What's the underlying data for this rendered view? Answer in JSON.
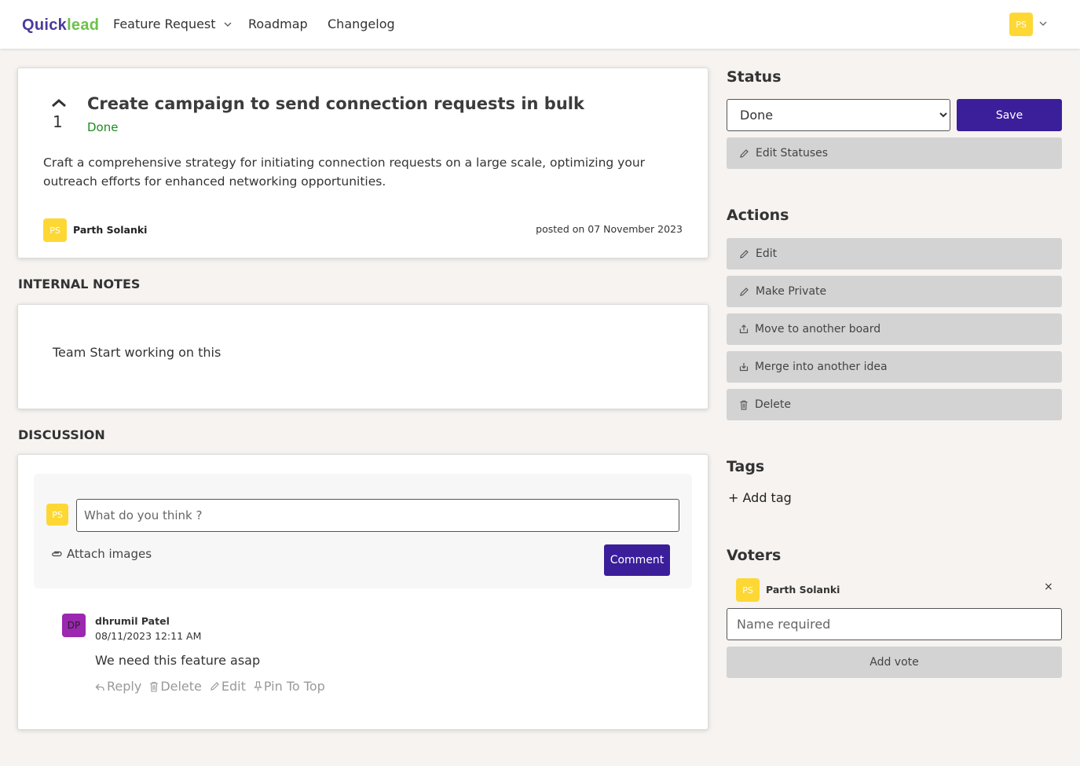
{
  "header": {
    "logo_part1": "Quick",
    "logo_part2": "lead",
    "nav": [
      {
        "label": "Feature Request",
        "has_dropdown": true
      },
      {
        "label": "Roadmap"
      },
      {
        "label": "Changelog"
      }
    ],
    "user_initials": "PS"
  },
  "post": {
    "vote_count": "1",
    "title": "Create campaign to send connection requests in bulk",
    "status": "Done",
    "description": "Craft a comprehensive strategy for initiating connection requests on a large scale, optimizing your outreach efforts for enhanced networking opportunities.",
    "author_initials": "PS",
    "author_name": "Parth Solanki",
    "posted_on": "posted on 07 November 2023"
  },
  "internal_notes": {
    "label": "INTERNAL NOTES",
    "text": "Team Start working on this"
  },
  "discussion": {
    "label": "DISCUSSION",
    "user_initials": "PS",
    "input_placeholder": "What do you think ?",
    "attach_label": "Attach images",
    "comment_button": "Comment",
    "comments": [
      {
        "initials": "DP",
        "author": "dhrumil Patel",
        "timestamp": "08/11/2023 12:11 AM",
        "text": "We need this feature asap",
        "actions": {
          "reply": "Reply",
          "delete": "Delete",
          "edit": "Edit",
          "pin": "Pin To Top"
        }
      }
    ]
  },
  "sidebar": {
    "status": {
      "title": "Status",
      "selected": "Done",
      "save_label": "Save",
      "edit_statuses_label": "Edit Statuses"
    },
    "actions": {
      "title": "Actions",
      "items": [
        "Edit",
        "Make Private",
        "Move to another board",
        "Merge into another idea",
        "Delete"
      ]
    },
    "tags": {
      "title": "Tags",
      "add_label": "+ Add tag"
    },
    "voters": {
      "title": "Voters",
      "list": [
        {
          "initials": "PS",
          "name": "Parth Solanki"
        }
      ],
      "remove_glyph": "×",
      "input_placeholder": "Name required",
      "add_vote_label": "Add vote"
    }
  },
  "colors": {
    "primary": "#3b1e9a",
    "status_done": "#1e8c1e",
    "avatar_yellow": "#fdd835",
    "avatar_purple": "#9c27b0",
    "button_gray": "#d3d3d3",
    "page_bg": "#f6f3f0"
  }
}
